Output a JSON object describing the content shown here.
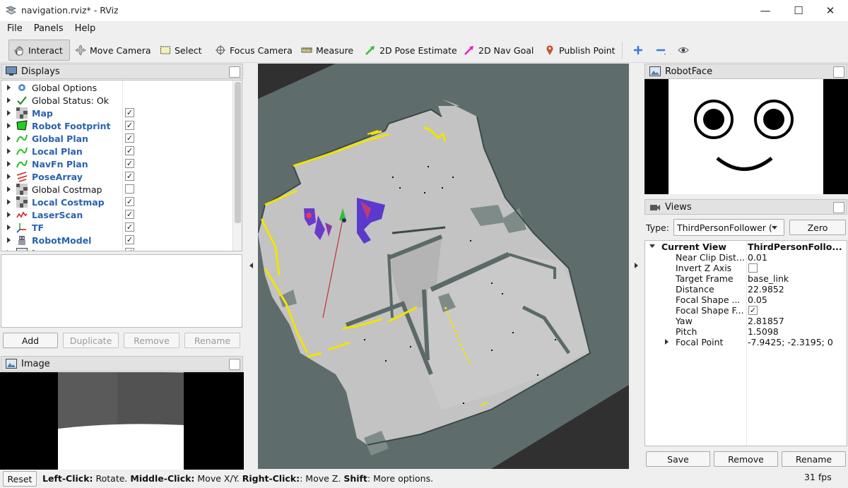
{
  "window": {
    "title": "navigation.rviz* - RViz",
    "minimize": "—",
    "maximize": "☐",
    "close": "✕"
  },
  "menu": [
    "File",
    "Panels",
    "Help"
  ],
  "toolbar": {
    "interact": "Interact",
    "move_camera": "Move Camera",
    "select": "Select",
    "focus_camera": "Focus Camera",
    "measure": "Measure",
    "pose_estimate": "2D Pose Estimate",
    "nav_goal": "2D Nav Goal",
    "publish_point": "Publish Point"
  },
  "displays": {
    "title": "Displays",
    "items": [
      {
        "label": "Global Options",
        "icon": "gear-icon",
        "bold": false,
        "checked": null
      },
      {
        "label": "Global Status: Ok",
        "icon": "checkmark-icon",
        "bold": false,
        "checked": null
      },
      {
        "label": "Map",
        "icon": "grid-icon",
        "bold": true,
        "checked": true
      },
      {
        "label": "Robot Footprint",
        "icon": "polygon-icon",
        "bold": true,
        "checked": true
      },
      {
        "label": "Global Plan",
        "icon": "path-icon",
        "bold": true,
        "checked": true
      },
      {
        "label": "Local Plan",
        "icon": "path-icon",
        "bold": true,
        "checked": true
      },
      {
        "label": "NavFn Plan",
        "icon": "path-icon",
        "bold": true,
        "checked": true
      },
      {
        "label": "PoseArray",
        "icon": "pose-array-icon",
        "bold": true,
        "checked": true
      },
      {
        "label": "Global Costmap",
        "icon": "grid-icon",
        "bold": false,
        "checked": false
      },
      {
        "label": "Local Costmap",
        "icon": "grid-icon",
        "bold": true,
        "checked": true
      },
      {
        "label": "LaserScan",
        "icon": "laser-icon",
        "bold": true,
        "checked": true
      },
      {
        "label": "TF",
        "icon": "axes-icon",
        "bold": true,
        "checked": true
      },
      {
        "label": "RobotModel",
        "icon": "robot-icon",
        "bold": true,
        "checked": true
      },
      {
        "label": "Image",
        "icon": "image-icon",
        "bold": true,
        "checked": true
      }
    ],
    "buttons": {
      "add": "Add",
      "duplicate": "Duplicate",
      "remove": "Remove",
      "rename": "Rename"
    }
  },
  "image_panel": {
    "title": "Image"
  },
  "robotface": {
    "title": "RobotFace"
  },
  "views": {
    "title": "Views",
    "type_label": "Type:",
    "type_value": "ThirdPersonFollower (",
    "zero": "Zero",
    "current_view": {
      "key": "Current View",
      "value": "ThirdPersonFollo..."
    },
    "props": [
      {
        "key": "Near Clip Dist...",
        "value": "0.01"
      },
      {
        "key": "Invert Z Axis",
        "value": "",
        "checkbox": false
      },
      {
        "key": "Target Frame",
        "value": "base_link"
      },
      {
        "key": "Distance",
        "value": "22.9852"
      },
      {
        "key": "Focal Shape ...",
        "value": "0.05"
      },
      {
        "key": "Focal Shape F...",
        "value": "",
        "checkbox": true
      },
      {
        "key": "Yaw",
        "value": "2.81857"
      },
      {
        "key": "Pitch",
        "value": "1.5098"
      },
      {
        "key": "Focal Point",
        "value": "-7.9425; -2.3195; 0"
      }
    ],
    "buttons": {
      "save": "Save",
      "remove": "Remove",
      "rename": "Rename"
    }
  },
  "status": {
    "reset": "Reset",
    "help_bold1": "Left-Click:",
    "help_t1": " Rotate. ",
    "help_bold2": "Middle-Click:",
    "help_t2": " Move X/Y. ",
    "help_bold3": "Right-Click:",
    "help_t3": ": Move Z. ",
    "help_bold4": "Shift",
    "help_t4": ": More options.",
    "fps": "31 fps"
  },
  "colors": {
    "viewport_bg": "#5f6e6d",
    "map_free": "#c8c8c8",
    "wall_yellow": "#f2e300",
    "link_blue": "#2a62b0"
  }
}
